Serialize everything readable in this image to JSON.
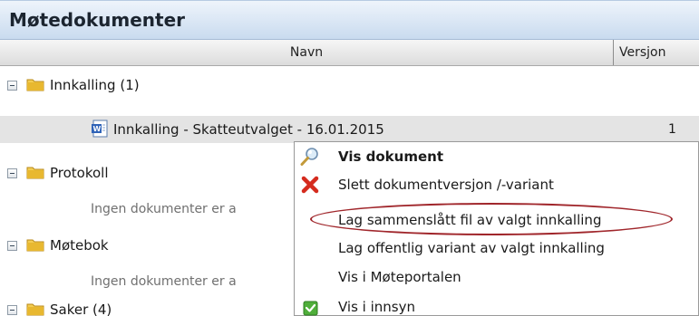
{
  "window": {
    "title": "Møtedokumenter"
  },
  "columns": {
    "name": "Navn",
    "version": "Versjon"
  },
  "tree": {
    "innkalling": {
      "label": "Innkalling (1)"
    },
    "innkalling_doc": {
      "label": "Innkalling - Skatteutvalget - 16.01.2015",
      "version": "1"
    },
    "protokoll": {
      "label": "Protokoll"
    },
    "protokoll_empty": {
      "label": "Ingen dokumenter er a"
    },
    "motebok": {
      "label": "Møtebok"
    },
    "motebok_empty": {
      "label": "Ingen dokumenter er a"
    },
    "saker": {
      "label": "Saker (4)"
    }
  },
  "context_menu": {
    "items": [
      {
        "label": "Vis dokument",
        "icon": "magnifier-icon"
      },
      {
        "label": "Slett dokumentversjon /-variant",
        "icon": "red-x-icon"
      },
      {
        "label": "Lag sammenslått fil av valgt innkalling",
        "icon": ""
      },
      {
        "label": "Lag offentlig variant av valgt innkalling",
        "icon": ""
      },
      {
        "label": "Vis i Møteportalen",
        "icon": ""
      },
      {
        "label": "Vis i innsyn",
        "icon": "green-check-icon"
      }
    ]
  },
  "colors": {
    "title_bg": "#c9dbef",
    "highlight_ring": "#a0262b",
    "folder": "#e8b830",
    "delete": "#d52b1e",
    "check": "#4fae3a"
  }
}
